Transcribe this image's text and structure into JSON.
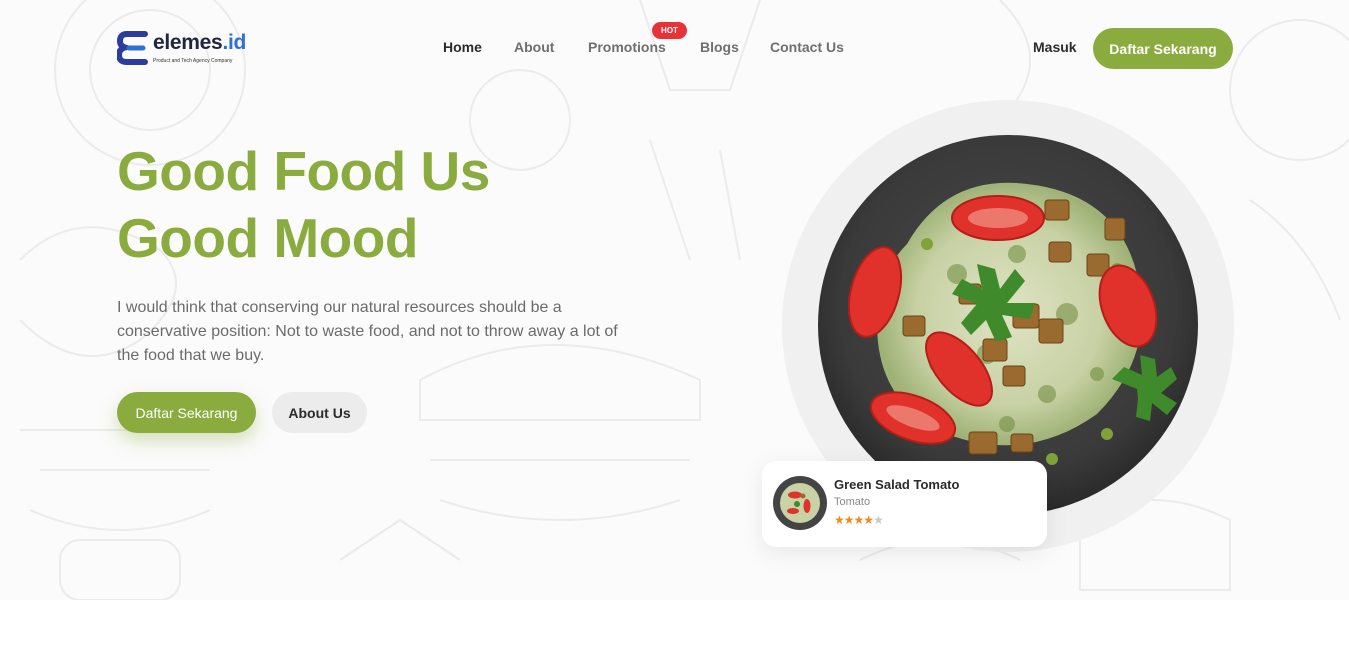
{
  "brand": {
    "name_main": "elemes",
    "name_suffix": ".id",
    "tagline": "Product and Tech Agency Company"
  },
  "nav": {
    "items": [
      "Home",
      "About",
      "Promotions",
      "Blogs",
      "Contact Us"
    ],
    "active": "Home",
    "badge": "HOT",
    "login": "Masuk",
    "signup": "Daftar Sekarang"
  },
  "hero": {
    "headline_line1": "Good Food Us",
    "headline_line2": "Good Mood",
    "description": "I would think that conserving our natural resources should be a conservative position: Not to waste food, and not to throw away a lot of the food that we buy.",
    "primary_button": "Daftar Sekarang",
    "secondary_button": "About Us"
  },
  "food_card": {
    "title": "Green Salad Tomato",
    "subtitle": "Tomato",
    "rating": 4,
    "rating_max": 5
  },
  "colors": {
    "accent": "#8aac3f",
    "badge": "#e8323a",
    "star": "#f08a1c",
    "logo_blue": "#2f6fd6"
  }
}
